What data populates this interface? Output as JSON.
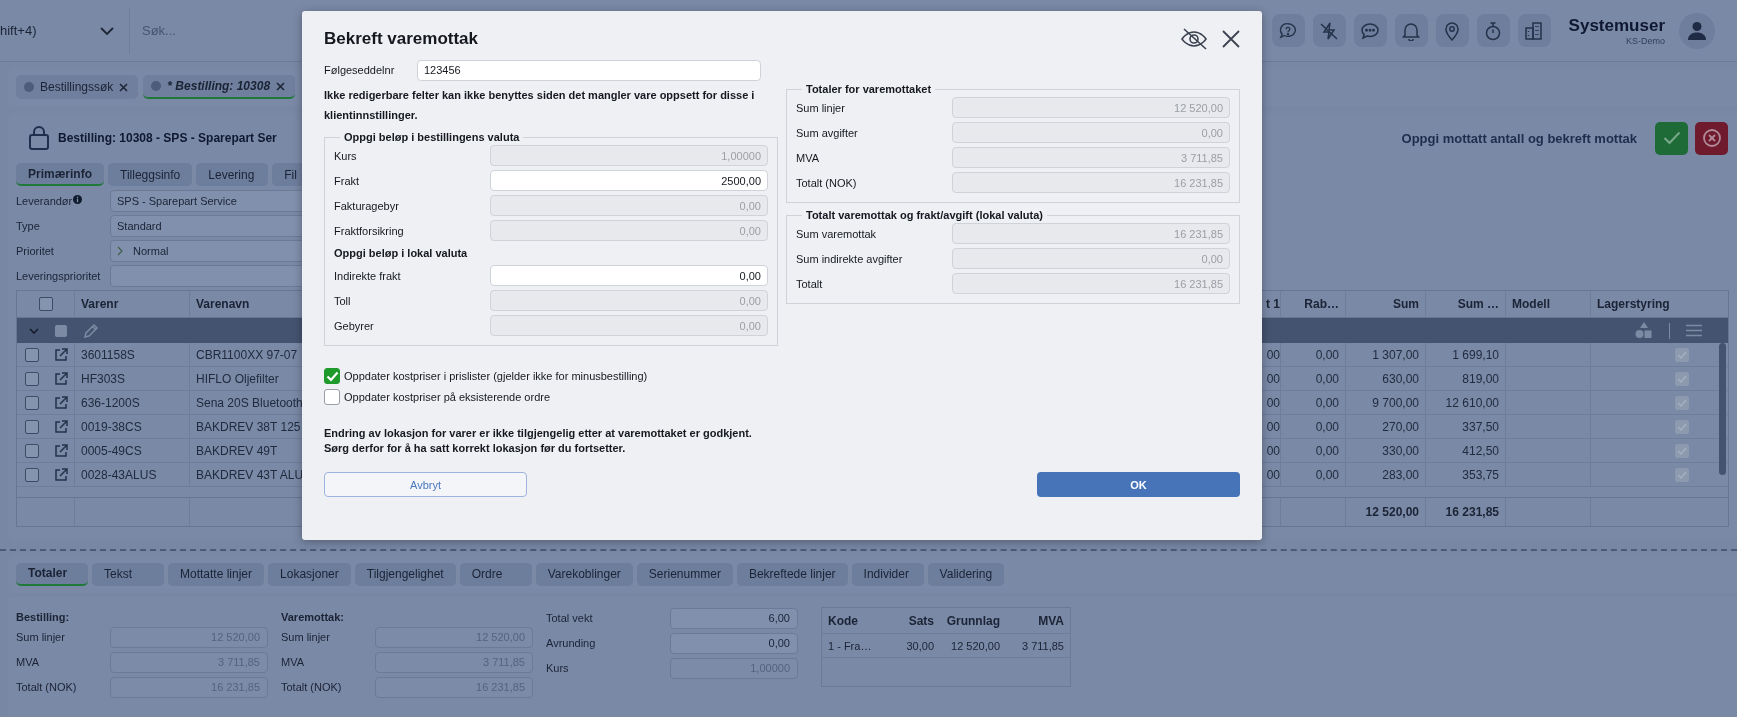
{
  "top_bar": {
    "shortcut_text": "hift+4)",
    "search": {
      "placeholder": "Søk..."
    },
    "user": {
      "name": "Systemuser",
      "company": "KS-Demo"
    }
  },
  "document_tabs": [
    {
      "label": "Bestillingssøk",
      "selected": false
    },
    {
      "label": "* Bestilling: 10308",
      "selected": true
    }
  ],
  "order": {
    "title": "Bestilling: 10308 - SPS - Sparepart Ser",
    "status_text": "Oppgi mottatt antall og bekreft mottak"
  },
  "order_tabs": [
    {
      "label": "Primærinfo",
      "selected": true
    },
    {
      "label": "Tilleggsinfo",
      "selected": false
    },
    {
      "label": "Levering",
      "selected": false
    },
    {
      "label": "Fil",
      "selected": false
    }
  ],
  "order_fields": [
    {
      "label": "Leverandør",
      "info": true,
      "kind": "text",
      "value": "SPS - Sparepart Service"
    },
    {
      "label": "Type",
      "info": false,
      "kind": "text",
      "value": "Standard"
    },
    {
      "label": "Prioritet",
      "info": false,
      "kind": "priority",
      "value": "Normal"
    },
    {
      "label": "Leveringsprioritet",
      "info": false,
      "kind": "text"
    }
  ],
  "lines": {
    "all_selected": false,
    "group_selected": false,
    "columns": {
      "varenr": "Varenr",
      "varenavn": "Varenavn",
      "column_3": "t 1",
      "rabatt": "Rab…",
      "sum": "Sum",
      "sum_2": "Sum …",
      "modell": "Modell",
      "lagerstyring": "Lagerstyring"
    },
    "rows": [
      {
        "selected": false,
        "varenr": "3601158S",
        "varenavn": "CBR1100XX 97-07",
        "column_3": "00",
        "rabatt": "0,00",
        "sum": "1 307,00",
        "sum_2": "1 699,10",
        "lagerstyring": true
      },
      {
        "selected": false,
        "varenr": "HF303S",
        "varenavn": "HIFLO Oljefilter",
        "column_3": "00",
        "rabatt": "0,00",
        "sum": "630,00",
        "sum_2": "819,00",
        "lagerstyring": true
      },
      {
        "selected": false,
        "varenr": "636-1200S",
        "varenavn": "Sena 20S Bluetooth",
        "column_3": "00",
        "rabatt": "0,00",
        "sum": "9 700,00",
        "sum_2": "12 610,00",
        "lagerstyring": true
      },
      {
        "selected": false,
        "varenr": "0019-38CS",
        "varenavn": "BAKDREV 38T 125",
        "column_3": "00",
        "rabatt": "0,00",
        "sum": "270,00",
        "sum_2": "337,50",
        "lagerstyring": true
      },
      {
        "selected": false,
        "varenr": "0005-49CS",
        "varenavn": "BAKDREV 49T",
        "column_3": "00",
        "rabatt": "0,00",
        "sum": "330,00",
        "sum_2": "412,50",
        "lagerstyring": true
      },
      {
        "selected": false,
        "varenr": "0028-43ALUS",
        "varenavn": "BAKDREV 43T ALU",
        "column_3": "00",
        "rabatt": "0,00",
        "sum": "283,00",
        "sum_2": "353,75",
        "lagerstyring": true
      }
    ],
    "footer": {
      "sum": "12 520,00",
      "sum_2": "16 231,85"
    }
  },
  "bottom_tabs": [
    {
      "label": "Totaler",
      "selected": true
    },
    {
      "label": "Tekst",
      "selected": false
    },
    {
      "label": "Mottatte linjer",
      "selected": false
    },
    {
      "label": "Lokasjoner",
      "selected": false
    },
    {
      "label": "Tilgjengelighet",
      "selected": false
    },
    {
      "label": "Ordre",
      "selected": false
    },
    {
      "label": "Varekoblinger",
      "selected": false
    },
    {
      "label": "Serienummer",
      "selected": false
    },
    {
      "label": "Bekreftede linjer",
      "selected": false
    },
    {
      "label": "Individer",
      "selected": false
    },
    {
      "label": "Validering",
      "selected": false
    }
  ],
  "totals": {
    "groups": [
      {
        "title": "Bestilling:",
        "fields": [
          {
            "label": "Sum linjer",
            "value": "12 520,00"
          },
          {
            "label": "MVA",
            "value": "3 711,85"
          },
          {
            "label": "Totalt (NOK)",
            "value": "16 231,85"
          }
        ]
      },
      {
        "title": "Varemottak:",
        "fields": [
          {
            "label": "Sum linjer",
            "value": "12 520,00"
          },
          {
            "label": "MVA",
            "value": "3 711,85"
          },
          {
            "label": "Totalt (NOK)",
            "value": "16 231,85"
          }
        ]
      }
    ],
    "misc_fields": [
      {
        "label": "Total vekt",
        "value": "6,00",
        "disabled": false
      },
      {
        "label": "Avrunding",
        "value": "0,00",
        "disabled": false
      },
      {
        "label": "Kurs",
        "value": "1,00000",
        "disabled": true
      }
    ],
    "vat_table": {
      "columns": [
        "Kode",
        "Sats",
        "Grunnlag",
        "MVA"
      ],
      "rows": [
        [
          "1 - Fra…",
          "30,00",
          "12 520,00",
          "3 711,85"
        ]
      ]
    }
  },
  "dialog": {
    "title": "Bekreft varemottak",
    "delivery_note": {
      "label": "Følgeseddelnr",
      "value": "123456"
    },
    "note": "Ikke redigerbare felter kan ikke benyttes siden det mangler vare oppsett for disse i klientinnstillinger.",
    "order_currency": {
      "title": "Oppgi beløp i bestillingens valuta",
      "fields": [
        {
          "label": "Kurs",
          "value": "1,00000",
          "disabled": true
        },
        {
          "label": "Frakt",
          "value": "2500,00",
          "disabled": false
        },
        {
          "label": "Fakturagebyr",
          "value": "0,00",
          "disabled": true
        },
        {
          "label": "Fraktforsikring",
          "value": "0,00",
          "disabled": true
        }
      ],
      "local_title": "Oppgi beløp i lokal valuta",
      "local_fields": [
        {
          "label": "Indirekte frakt",
          "value": "0,00",
          "disabled": false
        },
        {
          "label": "Toll",
          "value": "0,00",
          "disabled": true
        },
        {
          "label": "Gebyrer",
          "value": "0,00",
          "disabled": true
        }
      ]
    },
    "receipt_totals": {
      "title": "Totaler for varemottaket",
      "fields": [
        {
          "label": "Sum linjer",
          "value": "12 520,00",
          "disabled": true
        },
        {
          "label": "Sum avgifter",
          "value": "0,00",
          "disabled": true
        },
        {
          "label": "MVA",
          "value": "3 711,85",
          "disabled": true
        },
        {
          "label": "Totalt (NOK)",
          "value": "16 231,85",
          "disabled": true
        }
      ]
    },
    "local_totals": {
      "title": "Totalt varemottak og frakt/avgift (lokal valuta)",
      "fields": [
        {
          "label": "Sum varemottak",
          "value": "16 231,85",
          "disabled": true
        },
        {
          "label": "Sum indirekte avgifter",
          "value": "0,00",
          "disabled": true
        },
        {
          "label": "Totalt",
          "value": "16 231,85",
          "disabled": true
        }
      ]
    },
    "options": [
      {
        "label": "Oppdater kostpriser i prislister (gjelder ikke for minusbestilling)",
        "checked": true
      },
      {
        "label": "Oppdater kostpriser på eksisterende ordre",
        "checked": false
      }
    ],
    "warning_lines": [
      "Endring av lokasjon for varer er ikke tilgjengelig etter at varemottaket er godkjent.",
      "Sørg derfor for å ha satt korrekt lokasjon før du fortsetter."
    ],
    "cancel_button": "Avbryt",
    "ok_button": "OK"
  }
}
